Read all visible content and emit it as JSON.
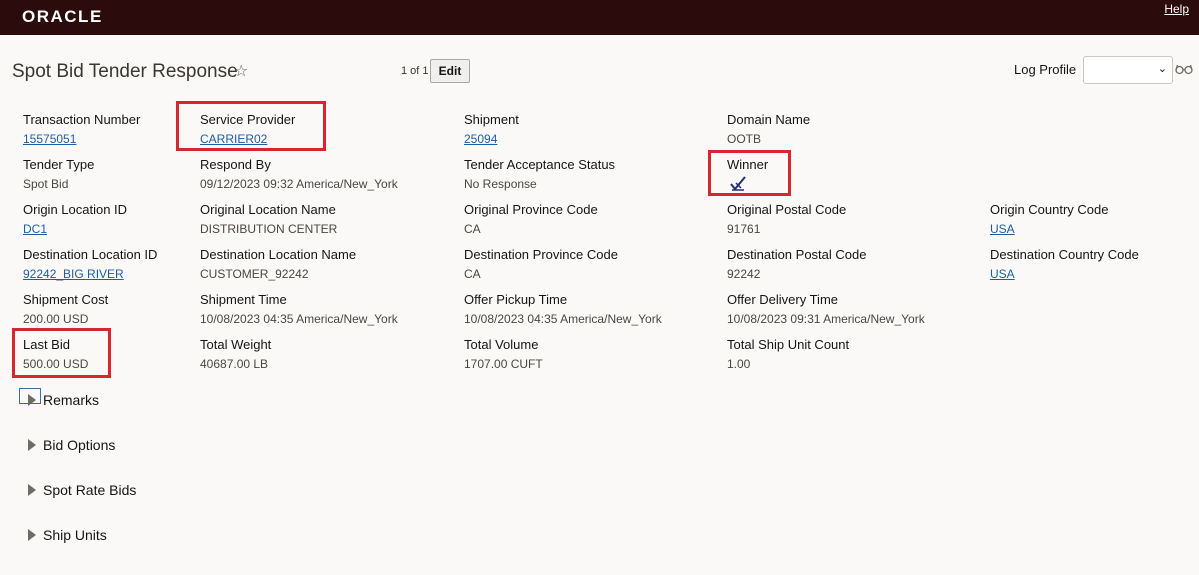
{
  "header": {
    "logo": "ORACLE",
    "help": "Help"
  },
  "page": {
    "title": "Spot Bid Tender Response",
    "pager": "1 of 1",
    "edit_label": "Edit",
    "log_profile_label": "Log Profile",
    "log_profile_value": ""
  },
  "fields": {
    "transaction_number": {
      "label": "Transaction Number",
      "value": "15575051"
    },
    "service_provider": {
      "label": "Service Provider",
      "value": "CARRIER02"
    },
    "shipment": {
      "label": "Shipment",
      "value": "25094"
    },
    "domain_name": {
      "label": "Domain Name",
      "value": "OOTB"
    },
    "tender_type": {
      "label": "Tender Type",
      "value": "Spot Bid"
    },
    "respond_by": {
      "label": "Respond By",
      "value": "09/12/2023 09:32 America/New_York"
    },
    "tender_acceptance_status": {
      "label": "Tender Acceptance Status",
      "value": "No Response"
    },
    "winner": {
      "label": "Winner",
      "icon": "winner-check-icon"
    },
    "origin_location_id": {
      "label": "Origin Location ID",
      "value": "DC1"
    },
    "original_location_name": {
      "label": "Original Location Name",
      "value": "DISTRIBUTION CENTER"
    },
    "original_province_code": {
      "label": "Original Province Code",
      "value": "CA"
    },
    "original_postal_code": {
      "label": "Original Postal Code",
      "value": "91761"
    },
    "origin_country_code": {
      "label": "Origin Country Code",
      "value": "USA"
    },
    "destination_location_id": {
      "label": "Destination Location ID",
      "value": "92242_BIG RIVER"
    },
    "destination_location_name": {
      "label": "Destination Location Name",
      "value": "CUSTOMER_92242"
    },
    "destination_province_code": {
      "label": "Destination Province Code",
      "value": "CA"
    },
    "destination_postal_code": {
      "label": "Destination Postal Code",
      "value": "92242"
    },
    "destination_country_code": {
      "label": "Destination Country Code",
      "value": "USA"
    },
    "shipment_cost": {
      "label": "Shipment Cost",
      "value": "200.00 USD"
    },
    "shipment_time": {
      "label": "Shipment Time",
      "value": "10/08/2023 04:35 America/New_York"
    },
    "offer_pickup_time": {
      "label": "Offer Pickup Time",
      "value": "10/08/2023 04:35 America/New_York"
    },
    "offer_delivery_time": {
      "label": "Offer Delivery Time",
      "value": "10/08/2023 09:31 America/New_York"
    },
    "last_bid": {
      "label": "Last Bid",
      "value": "500.00 USD"
    },
    "total_weight": {
      "label": "Total Weight",
      "value": "40687.00 LB"
    },
    "total_volume": {
      "label": "Total Volume",
      "value": "1707.00 CUFT"
    },
    "total_ship_unit_count": {
      "label": "Total Ship Unit Count",
      "value": "1.00"
    }
  },
  "sections": [
    "Remarks",
    "Bid Options",
    "Spot Rate Bids",
    "Ship Units"
  ],
  "colors": {
    "topbar": "#2b0b0b",
    "highlight": "#d7262f",
    "link": "#1a5ea8"
  }
}
